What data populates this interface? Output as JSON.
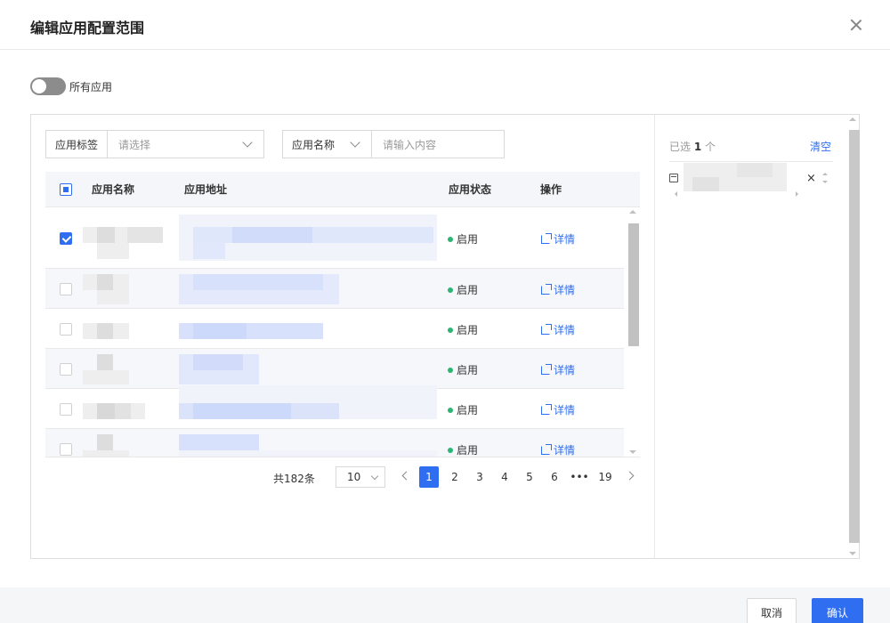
{
  "dialog": {
    "title": "编辑应用配置范围",
    "close_icon": "close-icon"
  },
  "toggle": {
    "label": "所有应用",
    "on": false
  },
  "filters": {
    "tag_label": "应用标签",
    "tag_placeholder": "请选择",
    "name_field": "应用名称",
    "name_placeholder": "请输入内容"
  },
  "table": {
    "columns": [
      "应用名称",
      "应用地址",
      "应用状态",
      "操作"
    ],
    "rows": [
      {
        "checked": true,
        "status": "启用",
        "action": "详情"
      },
      {
        "checked": false,
        "status": "启用",
        "action": "详情"
      },
      {
        "checked": false,
        "status": "启用",
        "action": "详情"
      },
      {
        "checked": false,
        "status": "启用",
        "action": "详情"
      },
      {
        "checked": false,
        "status": "启用",
        "action": "详情"
      },
      {
        "checked": false,
        "status": "启用",
        "action": "详情"
      }
    ]
  },
  "pagination": {
    "total": "共182条",
    "page_size": "10",
    "pages": [
      "1",
      "2",
      "3",
      "4",
      "5",
      "6",
      "•••",
      "19"
    ],
    "current": "1"
  },
  "selected": {
    "prefix": "已选",
    "count": "1",
    "suffix": "个",
    "clear": "清空"
  },
  "footer": {
    "cancel": "取消",
    "confirm": "确认"
  },
  "colors": {
    "primary": "#2f6ef0",
    "status_green": "#2bb673"
  }
}
